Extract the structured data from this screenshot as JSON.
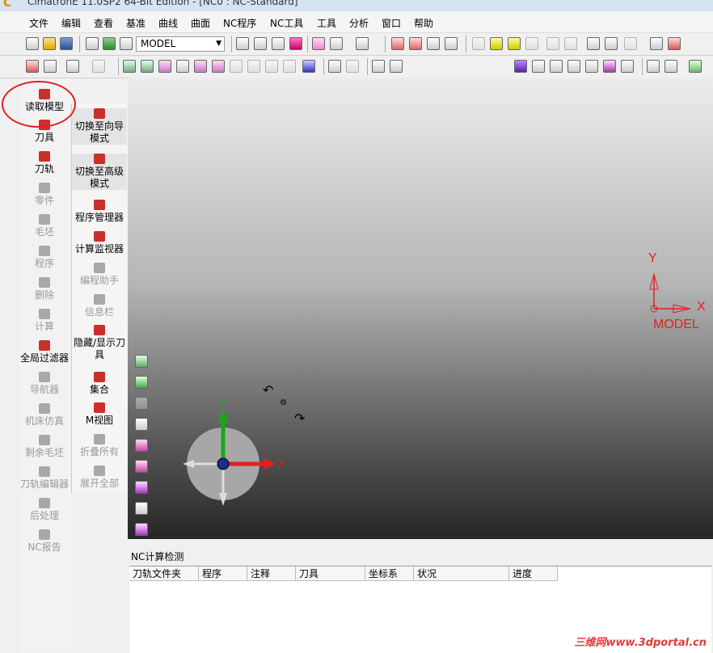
{
  "titlebar": {
    "title": "CimatronE 11.0SP2 64-Bit Edition - [NC0 : NC-Standard]"
  },
  "menu": [
    "文件",
    "编辑",
    "查看",
    "基准",
    "曲线",
    "曲面",
    "NC程序",
    "NC工具",
    "工具",
    "分析",
    "窗口",
    "帮助"
  ],
  "toolbar": {
    "model_select": "MODEL"
  },
  "left_panel": [
    {
      "label": "读取模型",
      "enabled": true
    },
    {
      "label": "刀具",
      "enabled": true
    },
    {
      "label": "刀轨",
      "enabled": true
    },
    {
      "label": "零件",
      "enabled": false
    },
    {
      "label": "毛坯",
      "enabled": false
    },
    {
      "label": "程序",
      "enabled": false
    },
    {
      "label": "删除",
      "enabled": false
    },
    {
      "label": "计算",
      "enabled": false
    },
    {
      "label": "全局过滤器",
      "enabled": true
    },
    {
      "label": "导航器",
      "enabled": false
    },
    {
      "label": "机床仿真",
      "enabled": false
    },
    {
      "label": "剩余毛坯",
      "enabled": false
    },
    {
      "label": "刀轨编辑器",
      "enabled": false
    },
    {
      "label": "后处理",
      "enabled": false
    },
    {
      "label": "NC报告",
      "enabled": false
    }
  ],
  "right_panel": [
    {
      "label": "切换至向导模式",
      "enabled": true
    },
    {
      "label": "切换至高级模式",
      "enabled": true
    },
    {
      "label": "程序管理器",
      "enabled": true
    },
    {
      "label": "计算监视器",
      "enabled": true
    },
    {
      "label": "编程助手",
      "enabled": false
    },
    {
      "label": "信息栏",
      "enabled": false
    },
    {
      "label": "隐藏/显示刀具",
      "enabled": true
    },
    {
      "label": "集合",
      "enabled": true
    },
    {
      "label": "M视图",
      "enabled": true
    },
    {
      "label": "折叠所有",
      "enabled": false
    },
    {
      "label": "展开全部",
      "enabled": false
    }
  ],
  "viewport": {
    "axis_x": "X",
    "axis_y": "Y",
    "model_label": "MODEL",
    "gizmo_x": "X",
    "gizmo_y": "Y"
  },
  "nc_panel": {
    "title": "NC计算检测",
    "columns": [
      "刀轨文件夹",
      "程序",
      "注释",
      "刀具",
      "坐标系",
      "状况",
      "进度"
    ]
  },
  "watermark": "三维网www.3dportal.cn",
  "colors": {
    "accent_red": "#e02020",
    "axis_green": "#1aa81a"
  }
}
